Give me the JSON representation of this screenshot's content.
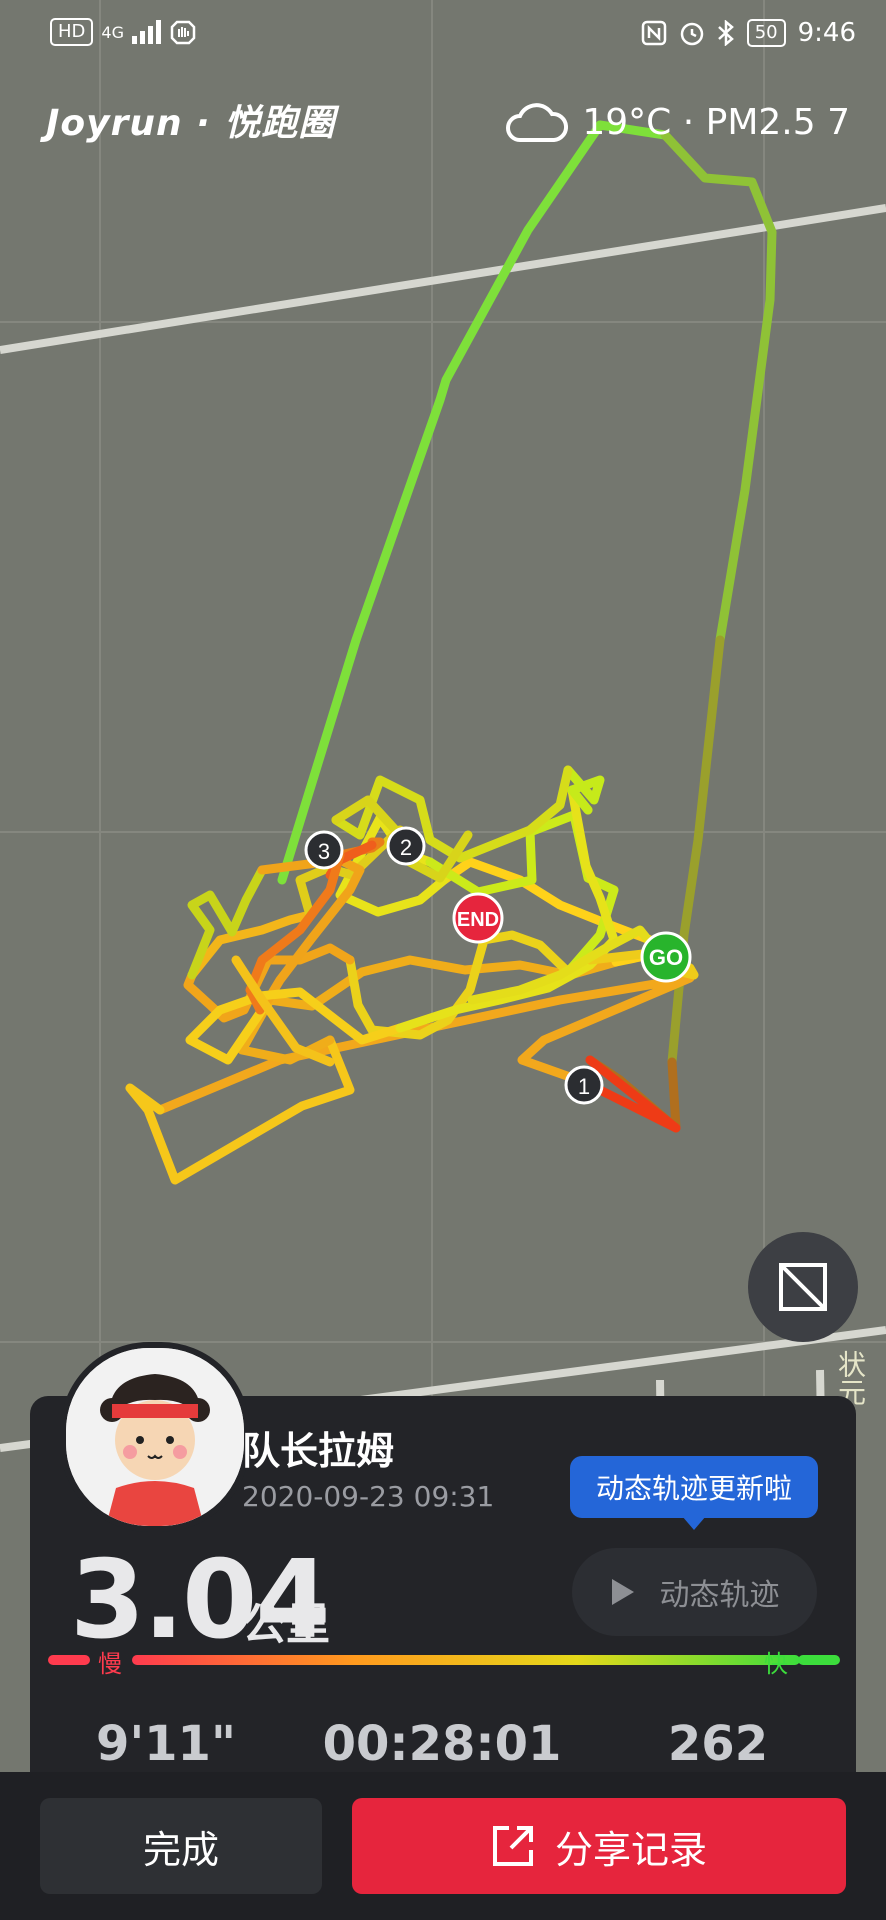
{
  "status_bar": {
    "left_badges": [
      "HD",
      "4G"
    ],
    "battery": "50",
    "time": "9:46"
  },
  "brand": {
    "logo_text": "Joyrun · 悦跑圈"
  },
  "weather": {
    "icon": "cloud-icon",
    "text": "19°C · PM2.5 7"
  },
  "map": {
    "markers": {
      "start": "GO",
      "end": "END",
      "km": [
        "1",
        "2",
        "3"
      ]
    },
    "road_label": "状元"
  },
  "card": {
    "username": "队长拉姆",
    "datetime": "2020-09-23 09:31",
    "tooltip": "动态轨迹更新啦",
    "replay_label": "动态轨迹",
    "distance_value": "3.04",
    "distance_unit": "公里",
    "slow_label": "慢",
    "fast_label": "快",
    "pace": "9'11\"",
    "duration": "00:28:01",
    "calories": "262"
  },
  "actions": {
    "done": "完成",
    "share": "分享记录"
  },
  "colors": {
    "accent_red": "#e6253d",
    "tooltip_blue": "#2466d8",
    "fast_green": "#3cdd3c",
    "slow_red": "#ff3b4e"
  }
}
